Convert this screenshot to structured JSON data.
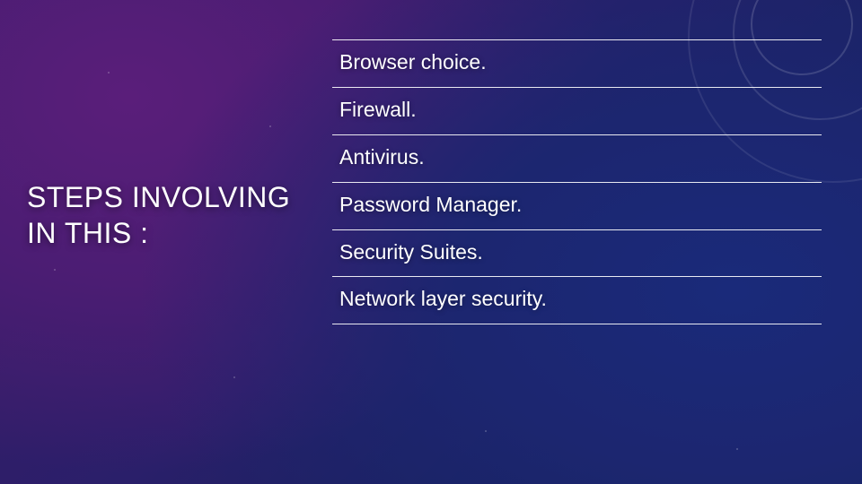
{
  "title": "STEPS INVOLVING IN THIS :",
  "items": [
    "Browser choice.",
    "Firewall.",
    "Antivirus.",
    "Password Manager.",
    "Security Suites.",
    "Network layer security."
  ],
  "colors": {
    "text": "#ffffff",
    "rule": "rgba(255,255,255,0.9)",
    "bg_gradient_start": "#3d1b66",
    "bg_gradient_end": "#122456"
  }
}
